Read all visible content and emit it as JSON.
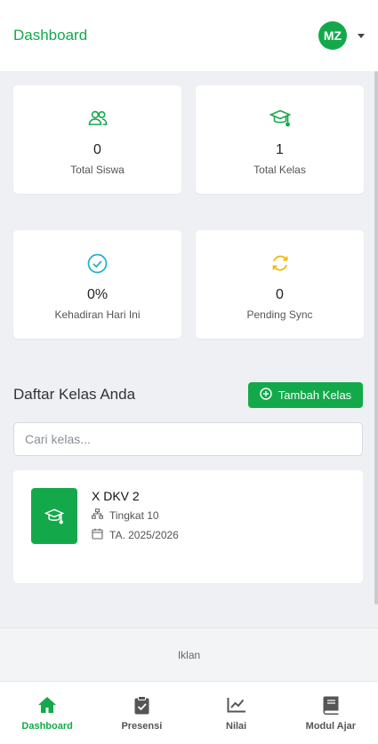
{
  "header": {
    "title": "Dashboard",
    "avatar_initials": "MZ"
  },
  "stats": [
    {
      "value": "0",
      "label": "Total Siswa",
      "icon": "users-icon",
      "color": "#13a94b"
    },
    {
      "value": "1",
      "label": "Total Kelas",
      "icon": "graduation-cap-icon",
      "color": "#13a94b"
    },
    {
      "value": "0%",
      "label": "Kehadiran Hari Ini",
      "icon": "check-circle-icon",
      "color": "#17b3c7"
    },
    {
      "value": "0",
      "label": "Pending Sync",
      "icon": "sync-icon",
      "color": "#f5b400"
    }
  ],
  "classes_section": {
    "title": "Daftar Kelas Anda",
    "add_button": "Tambah Kelas",
    "search_placeholder": "Cari kelas...",
    "items": [
      {
        "name": "X DKV 2",
        "level": "Tingkat 10",
        "year": "TA. 2025/2026"
      }
    ]
  },
  "ad": {
    "label": "Iklan"
  },
  "bottom_nav": [
    {
      "label": "Dashboard",
      "icon": "home-icon",
      "active": true
    },
    {
      "label": "Presensi",
      "icon": "clipboard-check-icon",
      "active": false
    },
    {
      "label": "Nilai",
      "icon": "chart-line-icon",
      "active": false
    },
    {
      "label": "Modul Ajar",
      "icon": "book-icon",
      "active": false
    }
  ],
  "colors": {
    "accent": "#13a94b",
    "info": "#17b3c7",
    "warning": "#f5b400"
  }
}
